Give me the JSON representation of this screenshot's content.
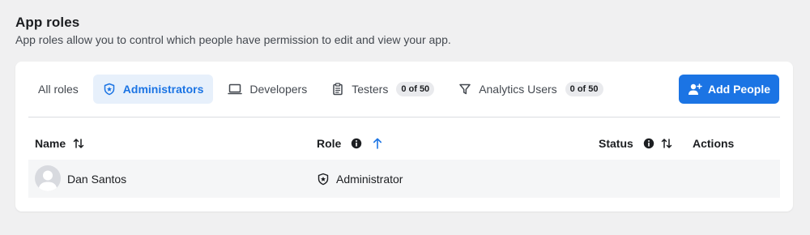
{
  "page": {
    "title": "App roles",
    "description": "App roles allow you to control which people have permission to edit and view your app."
  },
  "tabs": [
    {
      "label": "All roles",
      "icon": "none",
      "active": false
    },
    {
      "label": "Administrators",
      "icon": "shield-icon",
      "active": true
    },
    {
      "label": "Developers",
      "icon": "laptop-icon",
      "active": false
    },
    {
      "label": "Testers",
      "icon": "clipboard-icon",
      "active": false,
      "count": "0 of 50"
    },
    {
      "label": "Analytics Users",
      "icon": "filter-icon",
      "active": false,
      "count": "0 of 50"
    }
  ],
  "add_button": {
    "label": "Add People",
    "icon": "add-person-icon"
  },
  "table": {
    "columns": [
      {
        "label": "Name",
        "icon": "sort-icon"
      },
      {
        "label": "Role",
        "icon": "info-icon",
        "sort": "sort-ascending-icon"
      },
      {
        "label": "Status",
        "icon": "info-icon",
        "sort": "sort-icon"
      },
      {
        "label": "Actions"
      }
    ],
    "rows": [
      {
        "name": "Dan Santos",
        "avatar": "default-avatar-icon",
        "role": "Administrator",
        "role_icon": "shield-icon"
      }
    ]
  },
  "colors": {
    "accent": "#1b74e4",
    "active_tab_bg": "#e7f0fb",
    "page_bg": "#f0f0f1"
  }
}
